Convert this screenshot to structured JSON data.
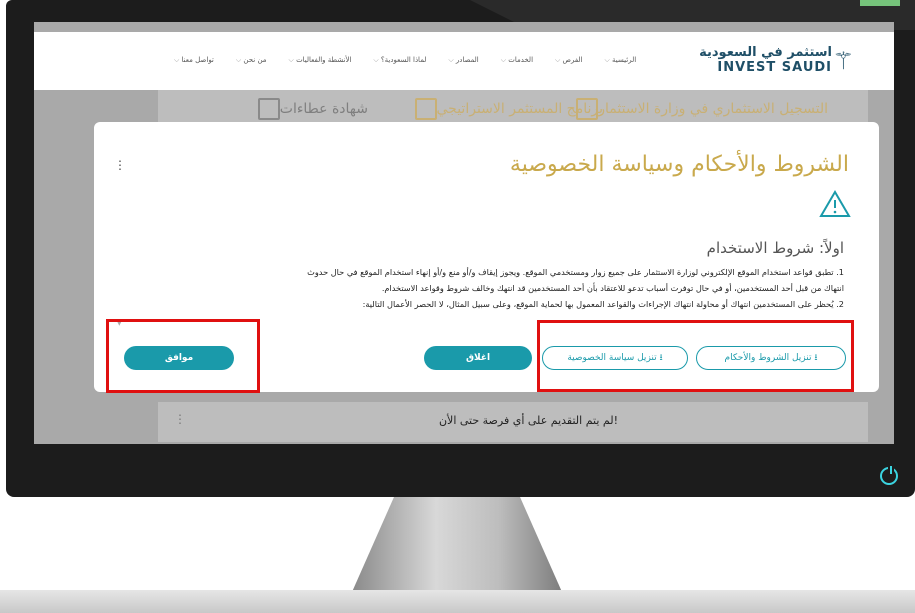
{
  "header": {
    "logo_ar": "استثمر في السعودية",
    "logo_en": "INVEST SAUDI",
    "nav": [
      "الرئيسية",
      "الفرص",
      "الخدمات",
      "المصادر",
      "لماذا السعودية؟",
      "الأنشطة والفعاليات",
      "من نحن",
      "تواصل معنا"
    ]
  },
  "tabs": [
    {
      "label": "التسجيل الاستثماري في وزارة الاستثمار"
    },
    {
      "label": "برنامج المستثمر الاستراتيجي"
    },
    {
      "label": "شهادة عطاءات"
    }
  ],
  "modal": {
    "title": "الشروط والأحكام وسياسة الخصوصية",
    "section_title": "اولاً: شروط الاستخدام",
    "line1": "1. تطبق قواعد استخدام الموقع الإلكتروني لوزارة الاستثمار على جميع زوار ومستخدمي الموقع. ويجوز إيقاف و/أو منع و/أو إنهاء استخدام الموقع في حال حدوث",
    "line2": "انتهاك من قبل أحد المستخدمين، أو في حال توفرت أسباب تدعو للاعتقاد بأن أحد المستخدمين قد انتهك وخالف شروط وقواعد الاستخدام.",
    "line3": "2. يُحظر على المستخدمين انتهاك أو محاولة انتهاك الإجراءات والقواعد المعمول بها لحماية الموقع، وعلى سبيل المثال، لا الحصر الأعمال التالية:",
    "buttons": {
      "download_terms": "تنزيل الشروط والأحكام ⭳",
      "download_privacy": "تنزيل سياسة الخصوصية ⭳",
      "close": "اغلاق",
      "agree": "موافق"
    }
  },
  "bottom_notice": "لم يتم التقديم على أي فرصة حتى الأن!",
  "colors": {
    "accent": "#1a9aaa",
    "gold": "#c9a94c",
    "highlight": "#e01010"
  }
}
